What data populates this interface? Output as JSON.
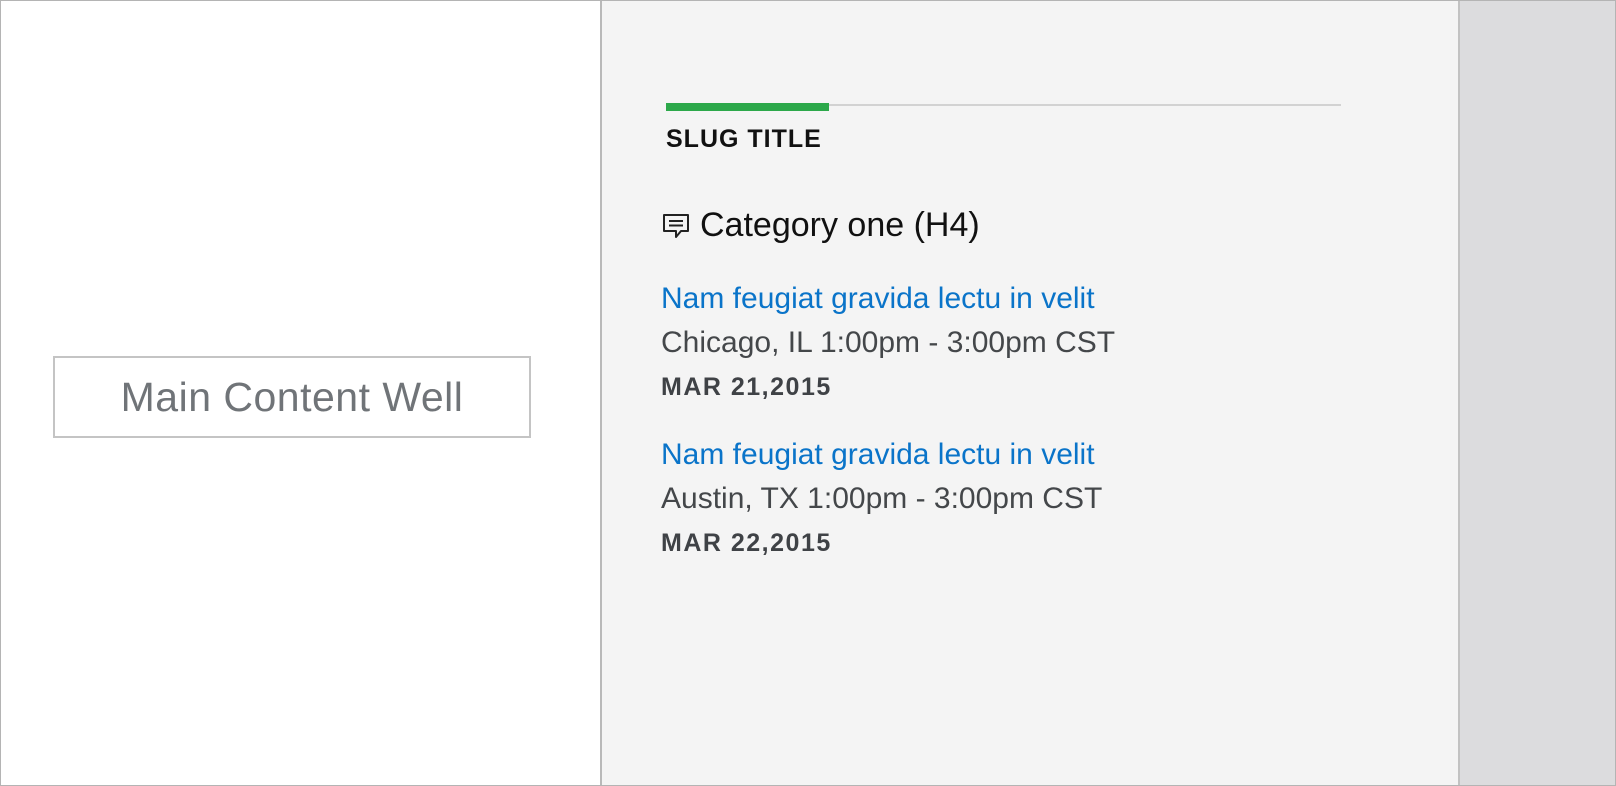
{
  "main": {
    "placeholder_label": "Main Content Well"
  },
  "sidebar": {
    "slug_title": "SLUG TITLE",
    "category": {
      "icon": "comment-icon",
      "title": "Category one (H4)"
    },
    "events": [
      {
        "title": "Nam feugiat gravida lectu in velit",
        "location_time": "Chicago, IL 1:00pm - 3:00pm CST",
        "date": "MAR 21,2015"
      },
      {
        "title": "Nam feugiat gravida lectu in velit",
        "location_time": "Austin, TX 1:00pm - 3:00pm CST",
        "date": "MAR 22,2015"
      }
    ]
  },
  "colors": {
    "accent": "#2ca84a",
    "link": "#0a74c9",
    "sidebar_bg": "#f4f4f4",
    "gutter_bg": "#dcdcde"
  }
}
